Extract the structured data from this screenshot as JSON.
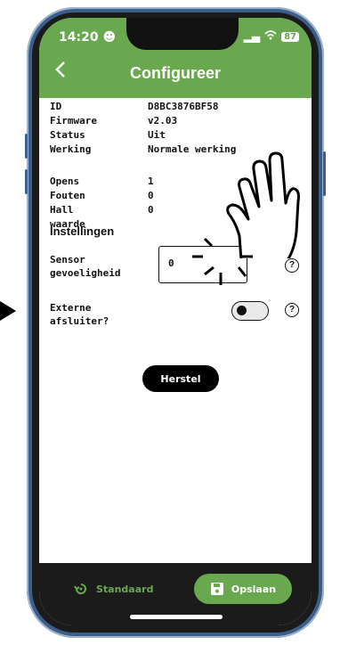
{
  "status_bar": {
    "time": "14:20",
    "battery": "87"
  },
  "header": {
    "back_icon": "chevron-left-icon",
    "title": "Configureer"
  },
  "info": [
    {
      "key": "ID",
      "value": "D8BC3876BF58"
    },
    {
      "key": "Firmware",
      "value": "v2.03"
    },
    {
      "key": "Status",
      "value": "Uit"
    },
    {
      "key": "Werking",
      "value": "Normale werking"
    }
  ],
  "stats": [
    {
      "key": "Opens",
      "value": "1"
    },
    {
      "key": "Fouten",
      "value": "0"
    },
    {
      "key": "Hall waarde",
      "value": "0"
    }
  ],
  "settings": {
    "title": "Instellingen",
    "sensor_label_1": "Sensor",
    "sensor_label_2": "gevoeligheid",
    "sensor_value": "0",
    "external_label_1": "Externe",
    "external_label_2": "afsluiter?",
    "external_enabled": false,
    "help_glyph": "?"
  },
  "actions": {
    "reset_label": "Herstel"
  },
  "bottom_bar": {
    "standard_label": "Standaard",
    "save_label": "Opslaan"
  },
  "colors": {
    "accent": "#6aa84f",
    "bottom_bar": "#1b1b1b",
    "frame": "#3b5f8a"
  }
}
